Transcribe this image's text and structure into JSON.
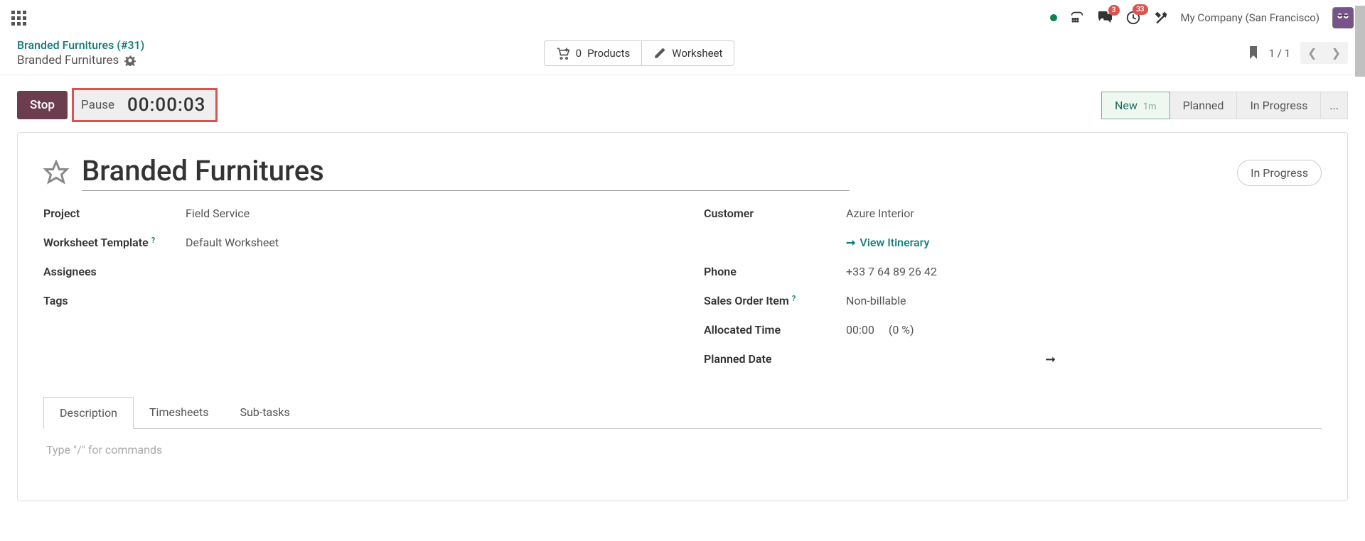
{
  "topbar": {
    "messages_badge": "3",
    "activities_badge": "33",
    "company_label": "My Company (San Francisco)"
  },
  "breadcrumb": {
    "parent": "Branded Furnitures (#31)",
    "title": "Branded Furnitures"
  },
  "actions": {
    "products_count": "0",
    "products_label": "Products",
    "worksheet_label": "Worksheet"
  },
  "pager": {
    "current": "1",
    "total": "1"
  },
  "timer": {
    "stop_label": "Stop",
    "pause_label": "Pause",
    "elapsed": "00:00:03"
  },
  "stages": {
    "new": "New",
    "new_age": "1m",
    "planned": "Planned",
    "in_progress": "In Progress",
    "more": "..."
  },
  "form": {
    "title": "Branded Furnitures",
    "status_chip": "In Progress",
    "labels": {
      "project": "Project",
      "worksheet_template": "Worksheet Template",
      "assignees": "Assignees",
      "tags": "Tags",
      "customer": "Customer",
      "phone": "Phone",
      "sales_order_item": "Sales Order Item",
      "allocated_time": "Allocated Time",
      "planned_date": "Planned Date"
    },
    "values": {
      "project": "Field Service",
      "worksheet_template": "Default Worksheet",
      "customer": "Azure Interior",
      "view_itinerary": "View Itinerary",
      "phone": "+33 7 64 89 26 42",
      "sales_order_item": "Non-billable",
      "allocated_time": "00:00",
      "allocated_pct": "(0 %)"
    }
  },
  "tabs": {
    "description": "Description",
    "timesheets": "Timesheets",
    "subtasks": "Sub-tasks"
  },
  "description_placeholder": "Type \"/\" for commands"
}
